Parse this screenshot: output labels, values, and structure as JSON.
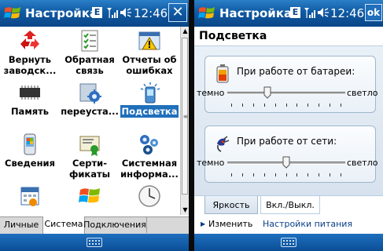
{
  "left": {
    "title": "Настройка",
    "status": {
      "edge": "E",
      "signal_icon": "signal-icon",
      "volume_icon": "volume-icon",
      "time": "12:46"
    },
    "close_label": "✕",
    "items": [
      {
        "label1": "Вернуть",
        "label2": "заводск...",
        "icon": "restore-icon"
      },
      {
        "label1": "Обратная",
        "label2": "связь",
        "icon": "feedback-icon"
      },
      {
        "label1": "Отчеты об",
        "label2": "ошибках",
        "icon": "error-report-icon"
      },
      {
        "label1": "Память",
        "label2": "",
        "icon": "memory-chip-icon"
      },
      {
        "label1": "переуста...",
        "label2": "",
        "icon": "reinstall-icon"
      },
      {
        "label1": "Подсветка",
        "label2": "",
        "icon": "backlight-icon"
      },
      {
        "label1": "Сведения",
        "label2": "",
        "icon": "about-icon"
      },
      {
        "label1": "Серти-",
        "label2": "фикаты",
        "icon": "certificates-icon"
      },
      {
        "label1": "Системная",
        "label2": "информа...",
        "icon": "system-info-icon"
      },
      {
        "label1": "",
        "label2": "",
        "icon": "calendar-icon"
      },
      {
        "label1": "",
        "label2": "",
        "icon": "windows-update-icon"
      },
      {
        "label1": "",
        "label2": "",
        "icon": "clock-icon"
      }
    ],
    "tabs": [
      "Личные",
      "Система",
      "Подключения"
    ],
    "active_tab": "Система"
  },
  "right": {
    "title": "Настройка",
    "status": {
      "edge": "E",
      "time": "12:46"
    },
    "ok_label": "ok",
    "page_title": "Подсветка",
    "battery": {
      "label": "При работе от батареи:",
      "min_label": "темно",
      "max_label": "светло",
      "level": 0.33
    },
    "ac": {
      "label": "При работе от сети:",
      "min_label": "темно",
      "max_label": "светло",
      "level": 0.5
    },
    "tabs": [
      "Яркость",
      "Вкл./Выкл."
    ],
    "active_tab": "Яркость",
    "link_prefix": "Изменить",
    "link_text": "Настройки питания"
  },
  "colors": {
    "titlebar": "#0f5aa3",
    "selection": "#1f6fbb",
    "link": "#0a3f86"
  }
}
